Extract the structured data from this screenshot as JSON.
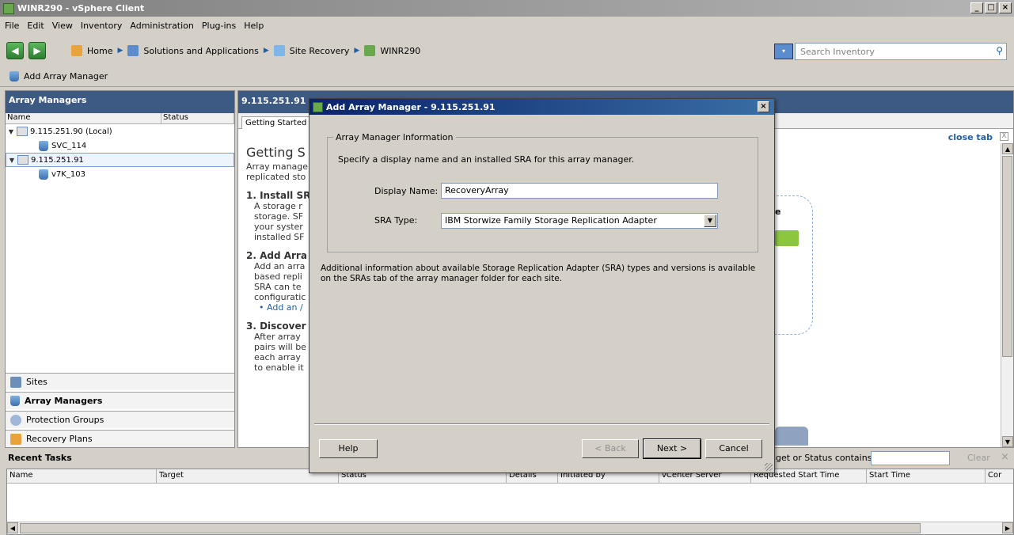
{
  "window": {
    "title": "WINR290 - vSphere Client",
    "btn_min": "_",
    "btn_max": "□",
    "btn_close": "×"
  },
  "menu": [
    "File",
    "Edit",
    "View",
    "Inventory",
    "Administration",
    "Plug-ins",
    "Help"
  ],
  "nav": {
    "back": "◀",
    "forward": "▶",
    "breadcrumb": [
      "Home",
      "Solutions and Applications",
      "Site Recovery",
      "WINR290"
    ],
    "search_placeholder": "Search Inventory"
  },
  "toolbar": {
    "add_array_manager": "Add Array Manager"
  },
  "left_panel": {
    "title": "Array Managers",
    "col_name": "Name",
    "col_status": "Status",
    "tree": [
      {
        "label": "9.115.251.90 (Local)",
        "child": "SVC_114"
      },
      {
        "label": "9.115.251.91",
        "child": "v7K_103"
      }
    ],
    "nav_buttons": [
      "Sites",
      "Array Managers",
      "Protection Groups",
      "Recovery Plans"
    ]
  },
  "main_panel": {
    "title": "9.115.251.91",
    "tab": "Getting Started",
    "close_tab": "close tab",
    "close_x": "X",
    "heading": "Getting S",
    "intro": [
      "Array manage",
      "replicated sto"
    ],
    "step1_title": "1. Install SR",
    "step1_lines": [
      "A storage r",
      "storage. SF",
      "your syster",
      "installed SF"
    ],
    "step2_title": "2. Add Arra",
    "step2_lines": [
      "Add an arra",
      "based repli",
      "SRA can te",
      "configuratic"
    ],
    "step2_link": "Add an /",
    "step3_title": "3. Discover",
    "step3_lines": [
      "After array",
      "pairs will be",
      "each array",
      "to enable it"
    ],
    "e_letter": "e"
  },
  "recent_tasks": {
    "title": "Recent Tasks",
    "filter_label": "get or Status contains: ▾",
    "clear": "Clear",
    "close": "×",
    "columns": [
      "Name",
      "Target",
      "Status",
      "Details",
      "Initiated by",
      "vCenter Server",
      "Requested Start Time",
      "Start Time",
      "Cor"
    ]
  },
  "dialog": {
    "title": "Add Array Manager - 9.115.251.91",
    "close": "×",
    "group_label": "Array Manager Information",
    "description": "Specify a display name and an installed SRA for this array manager.",
    "display_name_label": "Display Name:",
    "display_name_value": "RecoveryArray",
    "sra_type_label": "SRA Type:",
    "sra_type_value": "IBM Storwize Family Storage Replication Adapter",
    "info": "Additional information about available Storage Replication Adapter (SRA) types and versions is available on the SRAs tab of the array manager folder for each site.",
    "btn_help": "Help",
    "btn_back": "< Back",
    "btn_next": "Next >",
    "btn_cancel": "Cancel"
  }
}
